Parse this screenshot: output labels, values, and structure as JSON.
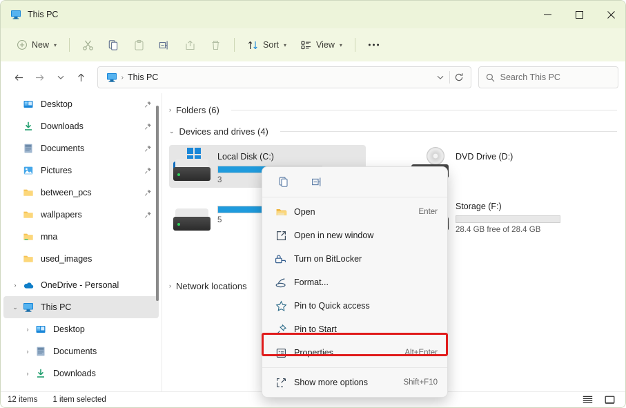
{
  "window": {
    "title": "This PC",
    "title_icon": "this-pc-monitor-icon",
    "controls": {
      "minimize": "—",
      "maximize": "☐",
      "close": "✕"
    },
    "accent": "#0f6cbd",
    "titlebar_color": "#edf4da",
    "toolbar_color": "#f2f7e2"
  },
  "toolbar": {
    "new_label": "New",
    "sort_label": "Sort",
    "view_label": "View",
    "more_label": "•••",
    "icons": [
      "plus-circle-icon",
      "cut-scissors-icon",
      "copy-icon",
      "paste-clipboard-icon",
      "rename-icon",
      "share-icon",
      "delete-trash-icon",
      "sort-arrows-icon",
      "view-list-icon",
      "more-ellipsis-icon"
    ],
    "chevron": "⌄"
  },
  "address": {
    "back": "←",
    "forward": "→",
    "recent": "⌄",
    "up": "↑",
    "crumb_icon": "this-pc-monitor-icon",
    "crumb_text": "This PC",
    "crumb_sep": "›",
    "dropdown": "⌄",
    "refresh": "↻",
    "search_placeholder": "Search This PC",
    "search_value": "",
    "search_icon": "search-icon"
  },
  "sidebar": {
    "quick_access": [
      {
        "label": "Desktop",
        "icon": "desktop-icon",
        "pinned": true,
        "arrow": ""
      },
      {
        "label": "Downloads",
        "icon": "downloads-icon",
        "pinned": true,
        "arrow": ""
      },
      {
        "label": "Documents",
        "icon": "documents-icon",
        "pinned": true,
        "arrow": ""
      },
      {
        "label": "Pictures",
        "icon": "pictures-icon",
        "pinned": true,
        "arrow": ""
      },
      {
        "label": "between_pcs",
        "icon": "folder-icon",
        "pinned": true,
        "arrow": ""
      },
      {
        "label": "wallpapers",
        "icon": "folder-icon",
        "pinned": true,
        "arrow": ""
      },
      {
        "label": "mna",
        "icon": "folder-icon",
        "pinned": false,
        "arrow": ""
      },
      {
        "label": "used_images",
        "icon": "folder-icon",
        "pinned": false,
        "arrow": ""
      }
    ],
    "tree": [
      {
        "label": "OneDrive - Personal",
        "icon": "onedrive-cloud-icon",
        "arrow": "›",
        "selected": false,
        "indent": 0
      },
      {
        "label": "This PC",
        "icon": "this-pc-monitor-icon",
        "arrow": "⌄",
        "selected": true,
        "indent": 0
      },
      {
        "label": "Desktop",
        "icon": "desktop-icon",
        "arrow": "›",
        "selected": false,
        "indent": 1
      },
      {
        "label": "Documents",
        "icon": "documents-icon",
        "arrow": "›",
        "selected": false,
        "indent": 1
      },
      {
        "label": "Downloads",
        "icon": "downloads-icon",
        "arrow": "›",
        "selected": false,
        "indent": 1
      }
    ],
    "pin_glyph": "📌"
  },
  "content": {
    "groups": [
      {
        "label": "Folders (6)",
        "expanded": false,
        "chevron": "›"
      },
      {
        "label": "Devices and drives (4)",
        "expanded": true,
        "chevron": "⌄"
      },
      {
        "label": "Network locations",
        "expanded": false,
        "chevron": "›"
      }
    ],
    "drives": [
      {
        "name": "Local Disk (C:)",
        "icon": "windows-drive-icon",
        "selected": true,
        "checked": true,
        "bar_percent": 72,
        "bar_color": "#1f9bdd",
        "free_text": "3"
      },
      {
        "name": "DVD Drive (D:)",
        "icon": "dvd-drive-icon",
        "selected": false,
        "checked": false,
        "bar_percent": 0,
        "bar_color": "",
        "free_text": ""
      },
      {
        "name": "",
        "icon": "hard-drive-icon",
        "selected": false,
        "checked": false,
        "bar_percent": 60,
        "bar_color": "#1f9bdd",
        "free_text": "5"
      },
      {
        "name": "Storage (F:)",
        "icon": "hard-drive-icon",
        "selected": false,
        "checked": false,
        "bar_percent": 0,
        "bar_color": "#cfcfcf",
        "free_text": "28.4 GB free of 28.4 GB"
      }
    ]
  },
  "context_menu": {
    "header_icons": [
      {
        "name": "copy-icon",
        "label": "Copy"
      },
      {
        "name": "rename-icon",
        "label": "Rename"
      }
    ],
    "items": [
      {
        "label": "Open",
        "icon": "open-folder-icon",
        "accel": "Enter",
        "highlighted": false
      },
      {
        "label": "Open in new window",
        "icon": "open-new-window-icon",
        "accel": "",
        "highlighted": false
      },
      {
        "label": "Turn on BitLocker",
        "icon": "bitlocker-lock-icon",
        "accel": "",
        "highlighted": false
      },
      {
        "label": "Format...",
        "icon": "format-disk-icon",
        "accel": "",
        "highlighted": false
      },
      {
        "label": "Pin to Quick access",
        "icon": "star-icon",
        "accel": "",
        "highlighted": false
      },
      {
        "label": "Pin to Start",
        "icon": "pin-icon",
        "accel": "",
        "highlighted": false
      },
      {
        "label": "Properties",
        "icon": "properties-icon",
        "accel": "Alt+Enter",
        "highlighted": true
      },
      {
        "label": "Show more options",
        "icon": "show-more-options-icon",
        "accel": "Shift+F10",
        "highlighted": false
      }
    ],
    "highlight_color": "#e01b1b"
  },
  "statusbar": {
    "item_count": "12 items",
    "selection": "1 item selected",
    "view_details_icon": "details-view-icon",
    "view_large_icon": "large-icons-view-icon"
  }
}
